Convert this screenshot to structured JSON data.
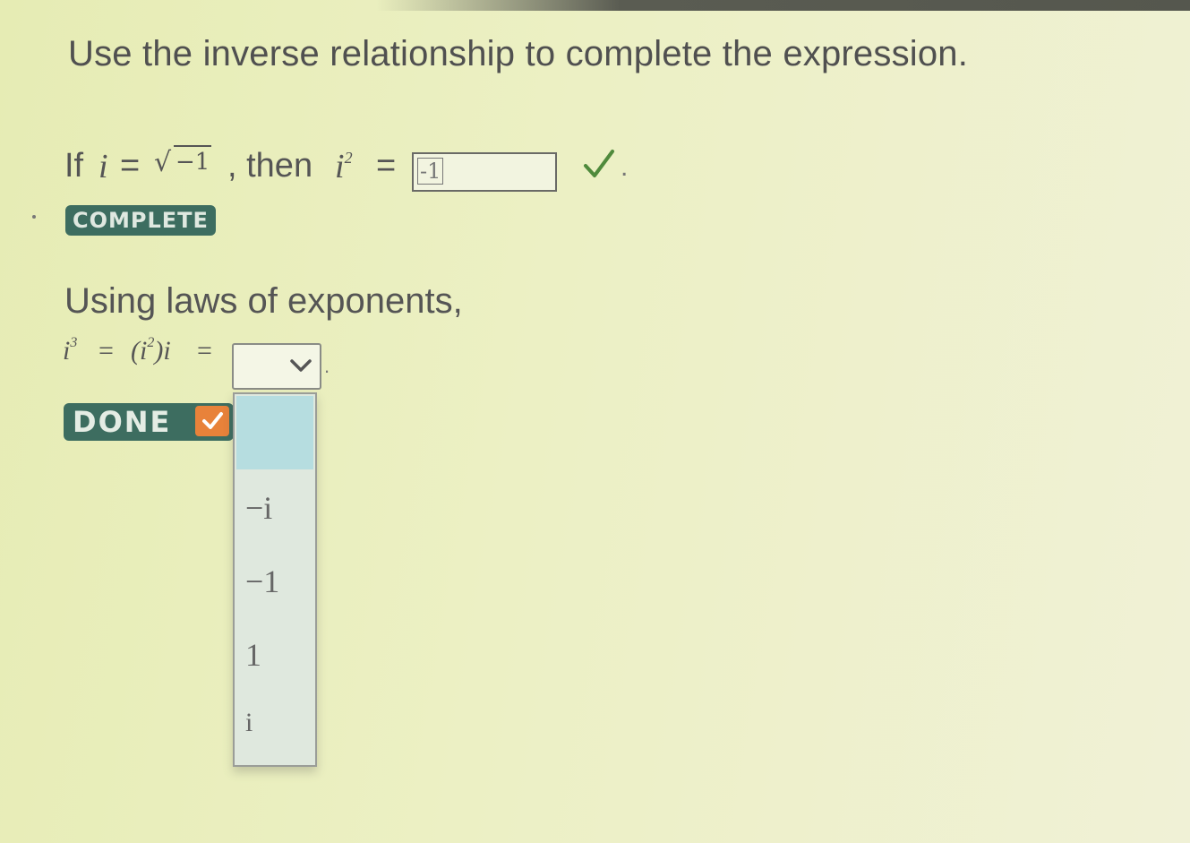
{
  "question": {
    "title": "Use the inverse relationship to complete the expression."
  },
  "step1": {
    "if_word": "If",
    "var_i": "i",
    "equals": "=",
    "radicand": "−1",
    "then_word": ", then",
    "var_i2": "i",
    "exponent": "2",
    "equals2": "=",
    "answer_value": "-1",
    "period": ".",
    "status_badge": "COMPLETE"
  },
  "step2": {
    "heading": "Using laws of exponents,",
    "expression_lhs": "i",
    "exponent_3": "3",
    "eq_a": "=",
    "paren_expr": "(i",
    "exponent_2": "2",
    "paren_close": ")i",
    "eq_b": "=",
    "period": ".",
    "status_badge": "DONE"
  },
  "dropdown": {
    "selected": "",
    "options": [
      "",
      "−i",
      "−1",
      "1",
      "i"
    ]
  },
  "colors": {
    "badge_bg": "#3d6d60",
    "check_green": "#4f8a3c",
    "done_check_orange": "#e8823a",
    "highlight_blue": "#b6dde0"
  }
}
